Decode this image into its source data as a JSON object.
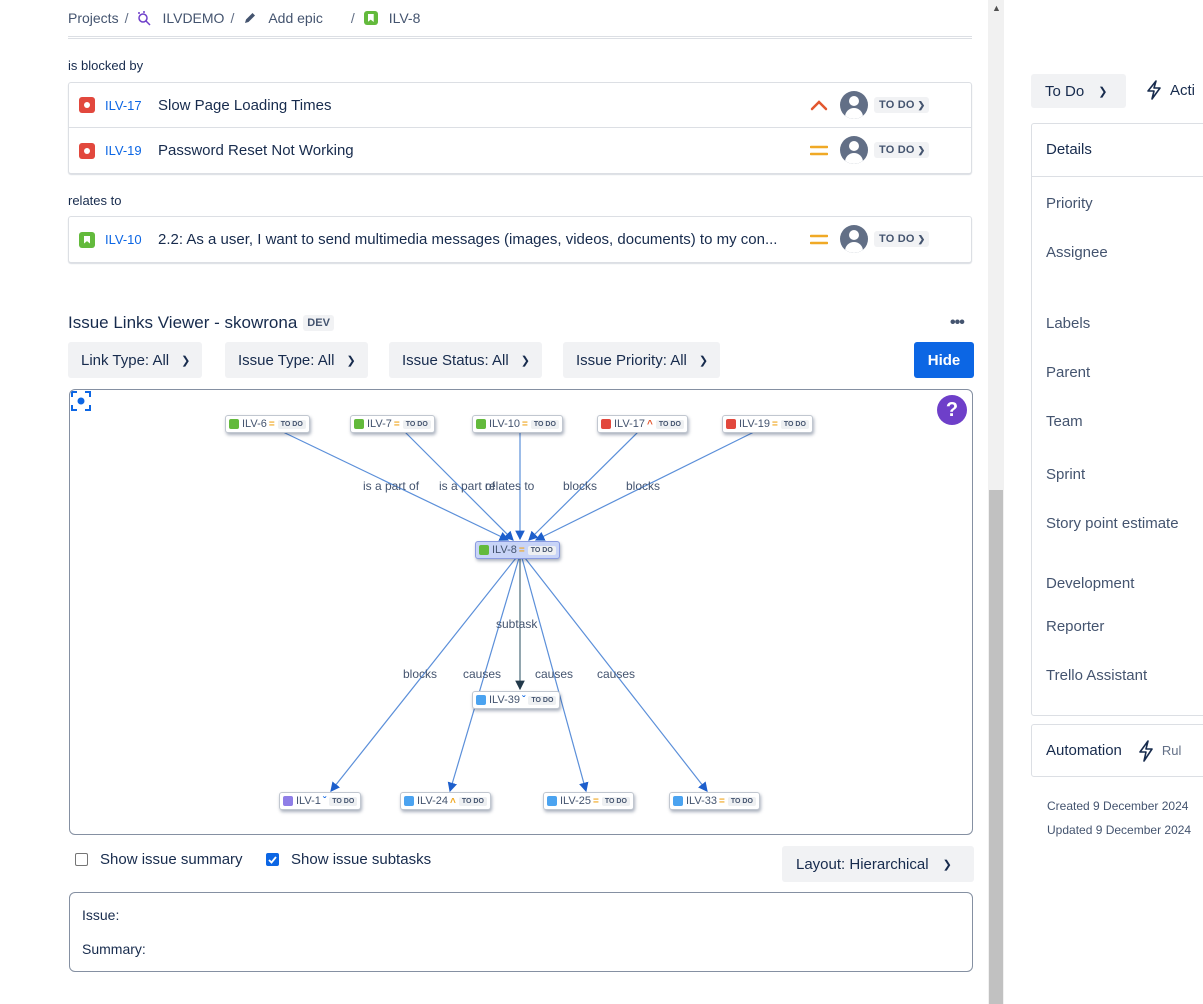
{
  "breadcrumb": {
    "projects": "Projects",
    "project": "ILVDEMO",
    "add_epic": "Add epic",
    "issue": "ILV-8"
  },
  "linked_issues": {
    "groups": [
      {
        "label": "is blocked by",
        "items": [
          {
            "key": "ILV-17",
            "summary": "Slow Page Loading Times",
            "type": "bug-icon",
            "priority": "high",
            "status": "TO DO"
          },
          {
            "key": "ILV-19",
            "summary": "Password Reset Not Working",
            "type": "bug-icon",
            "priority": "medium",
            "status": "TO DO"
          }
        ]
      },
      {
        "label": "relates to",
        "items": [
          {
            "key": "ILV-10",
            "summary": "2.2: As a user, I want to send multimedia messages (images, videos, documents) to my con...",
            "type": "story-icon",
            "priority": "medium",
            "status": "TO DO"
          }
        ]
      }
    ]
  },
  "ilv": {
    "title": "Issue Links Viewer - skowrona",
    "env_badge": "DEV",
    "filters": {
      "link_type": "Link Type: All",
      "issue_type": "Issue Type: All",
      "issue_status": "Issue Status: All",
      "issue_priority": "Issue Priority: All"
    },
    "hide_label": "Hide",
    "graph": {
      "status": "TO DO",
      "nodes": {
        "ilv6": "ILV-6",
        "ilv7": "ILV-7",
        "ilv10": "ILV-10",
        "ilv17": "ILV-17",
        "ilv19": "ILV-19",
        "ilv8": "ILV-8",
        "ilv39": "ILV-39",
        "ilv1": "ILV-1",
        "ilv24": "ILV-24",
        "ilv25": "ILV-25",
        "ilv33": "ILV-33"
      },
      "edge_labels": {
        "is_part_of_1": "is a part of",
        "is_part_of_2": "is a part of",
        "relates_to": "relates to",
        "blocks_1": "blocks",
        "blocks_2": "blocks",
        "subtask": "subtask",
        "blocks_3": "blocks",
        "causes_1": "causes",
        "causes_2": "causes",
        "causes_3": "causes"
      }
    },
    "show_summary": "Show issue summary",
    "show_subtasks": "Show issue subtasks",
    "layout": "Layout: Hierarchical",
    "info": {
      "issue_label": "Issue:",
      "summary_label": "Summary:"
    }
  },
  "sidebar": {
    "status": "To Do",
    "actions": "Acti",
    "details_title": "Details",
    "fields": {
      "priority": "Priority",
      "assignee": "Assignee",
      "labels": "Labels",
      "parent": "Parent",
      "team": "Team",
      "sprint": "Sprint",
      "story_points": "Story point estimate",
      "development": "Development",
      "reporter": "Reporter",
      "trello": "Trello Assistant"
    },
    "automation": "Automation",
    "rules": "Rul",
    "created": "Created 9 December 2024",
    "updated": "Updated 9 December 2024"
  },
  "colors": {
    "accent_blue": "#0c66e4",
    "bug_red": "#e2483d",
    "story_green": "#63ba3c",
    "priority_medium": "#f0a926",
    "priority_high": "#e2572f",
    "help_purple": "#6e3fc9"
  }
}
